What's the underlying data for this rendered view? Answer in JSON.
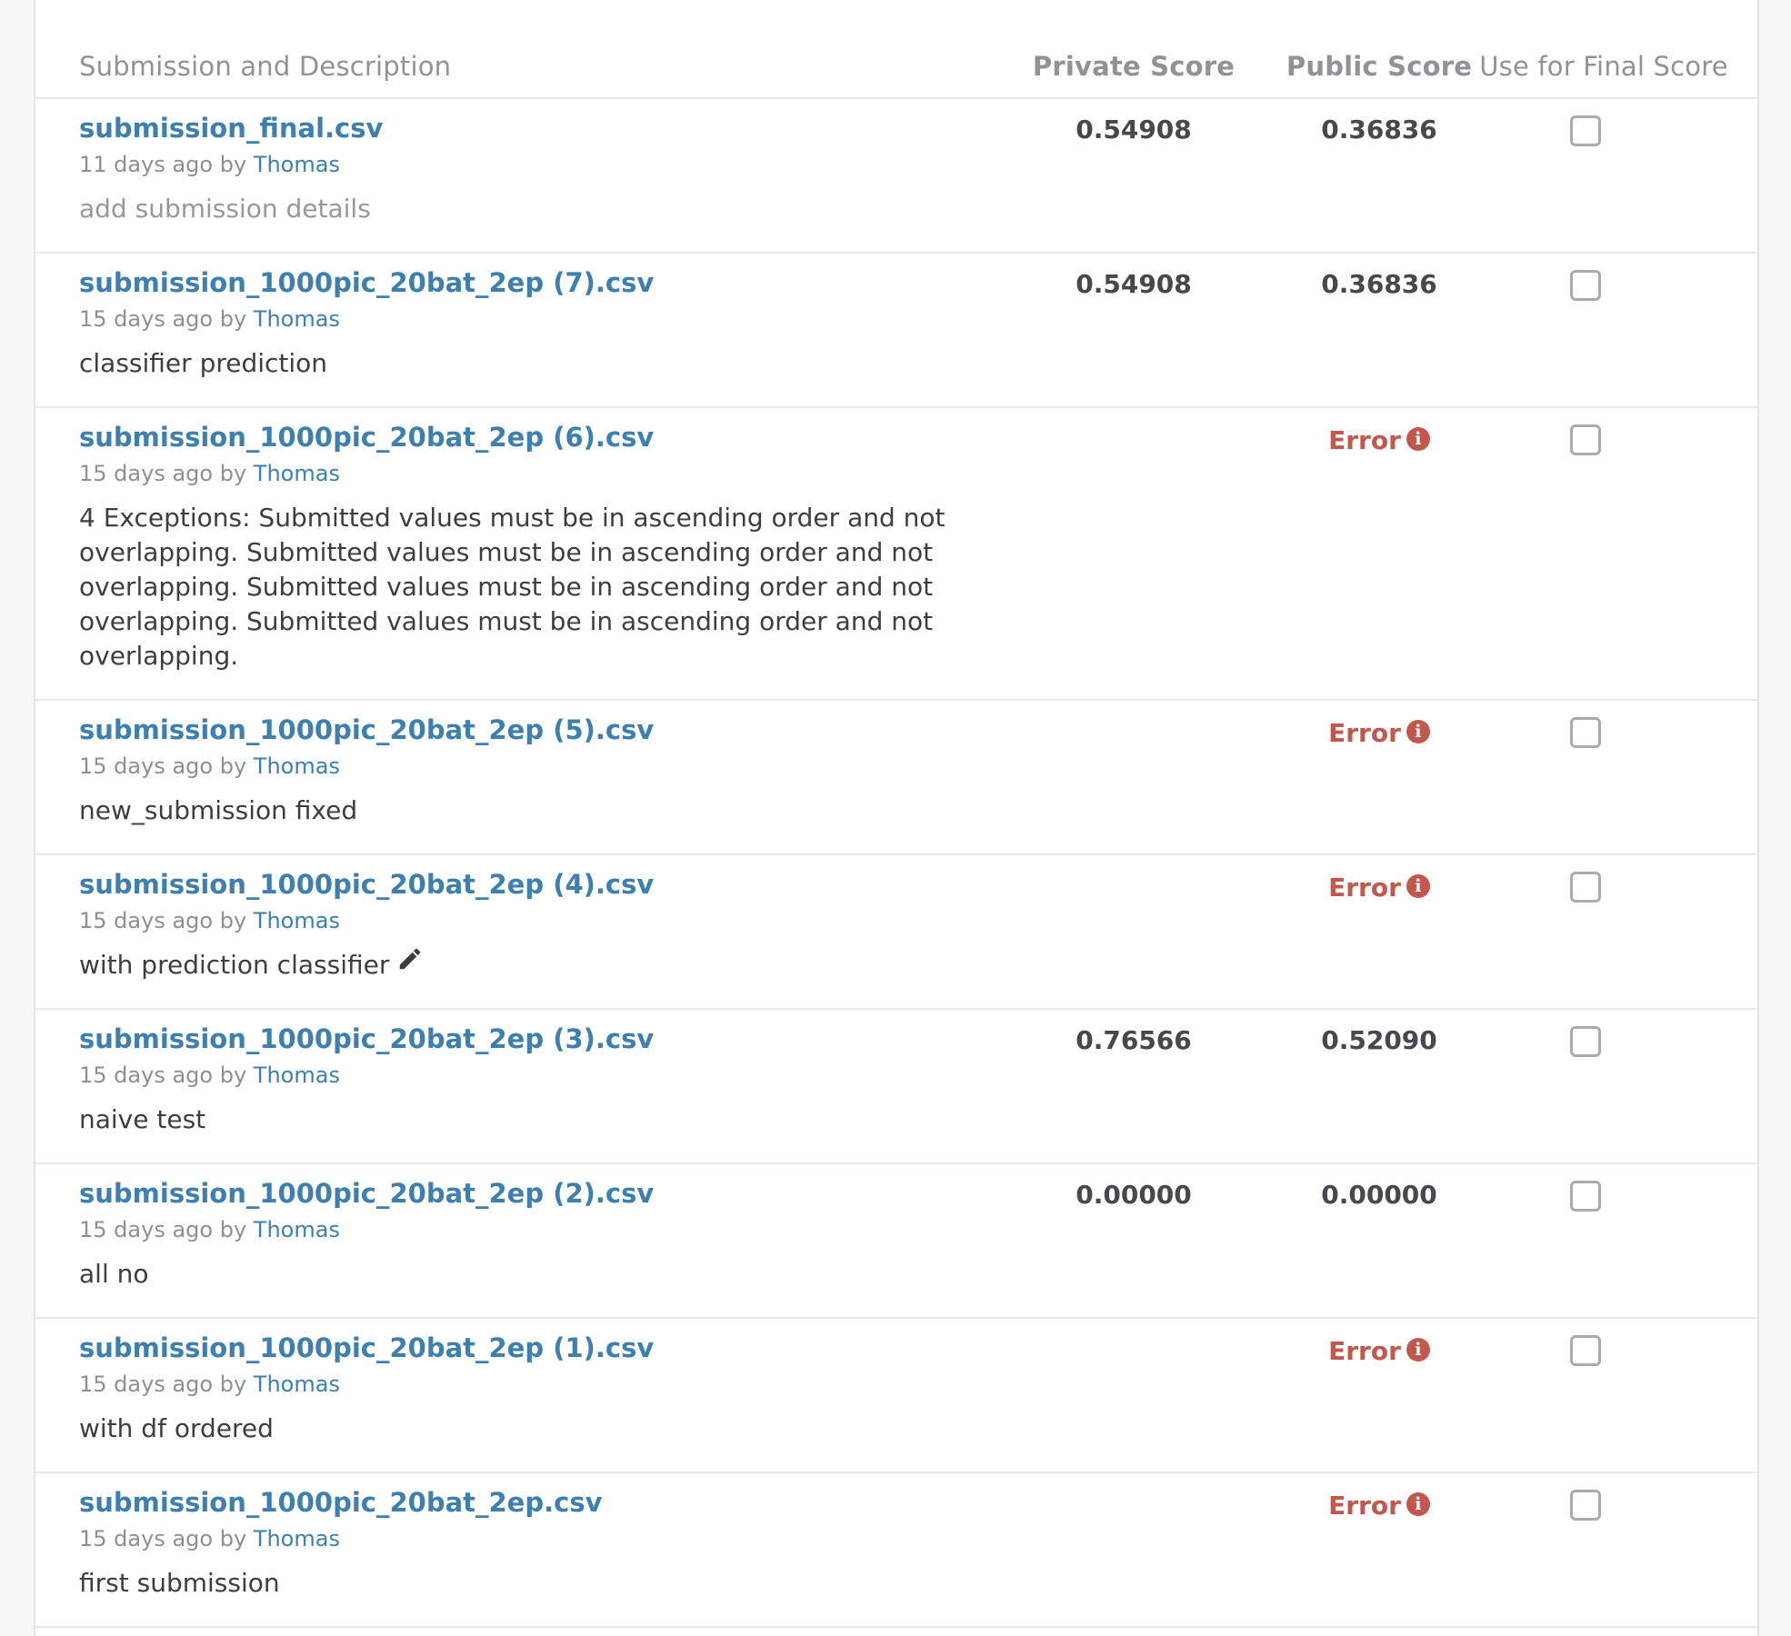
{
  "header": {
    "submission": "Submission and Description",
    "private": "Private Score",
    "public": "Public Score",
    "final": "Use for Final Score"
  },
  "rows": [
    {
      "file": "submission_final.csv",
      "time": "11 days ago",
      "by": "by",
      "author": "Thomas",
      "description": "add submission details",
      "private": "0.54908",
      "public": "0.36836",
      "error": null
    },
    {
      "file": "submission_1000pic_20bat_2ep (7).csv",
      "time": "15 days ago",
      "by": "by",
      "author": "Thomas",
      "description": "classifier prediction",
      "private": "0.54908",
      "public": "0.36836",
      "error": null
    },
    {
      "file": "submission_1000pic_20bat_2ep (6).csv",
      "time": "15 days ago",
      "by": "by",
      "author": "Thomas",
      "description": "4 Exceptions: Submitted values must be in ascending order and not overlapping. Submitted values must be in ascending order and not overlapping. Submitted values must be in ascending order and not overlapping. Submitted values must be in ascending order and not overlapping.",
      "private": null,
      "public": null,
      "error": "Error"
    },
    {
      "file": "submission_1000pic_20bat_2ep (5).csv",
      "time": "15 days ago",
      "by": "by",
      "author": "Thomas",
      "description": "new_submission fixed",
      "private": null,
      "public": null,
      "error": "Error"
    },
    {
      "file": "submission_1000pic_20bat_2ep (4).csv",
      "time": "15 days ago",
      "by": "by",
      "author": "Thomas",
      "description": "with prediction classifier",
      "private": null,
      "public": null,
      "error": "Error"
    },
    {
      "file": "submission_1000pic_20bat_2ep (3).csv",
      "time": "15 days ago",
      "by": "by",
      "author": "Thomas",
      "description": "naive test",
      "private": "0.76566",
      "public": "0.52090",
      "error": null
    },
    {
      "file": "submission_1000pic_20bat_2ep (2).csv",
      "time": "15 days ago",
      "by": "by",
      "author": "Thomas",
      "description": "all no",
      "private": "0.00000",
      "public": "0.00000",
      "error": null
    },
    {
      "file": "submission_1000pic_20bat_2ep (1).csv",
      "time": "15 days ago",
      "by": "by",
      "author": "Thomas",
      "description": "with df ordered",
      "private": null,
      "public": null,
      "error": "Error"
    },
    {
      "file": "submission_1000pic_20bat_2ep.csv",
      "time": "15 days ago",
      "by": "by",
      "author": "Thomas",
      "description": "first submission",
      "private": null,
      "public": null,
      "error": "Error"
    }
  ]
}
